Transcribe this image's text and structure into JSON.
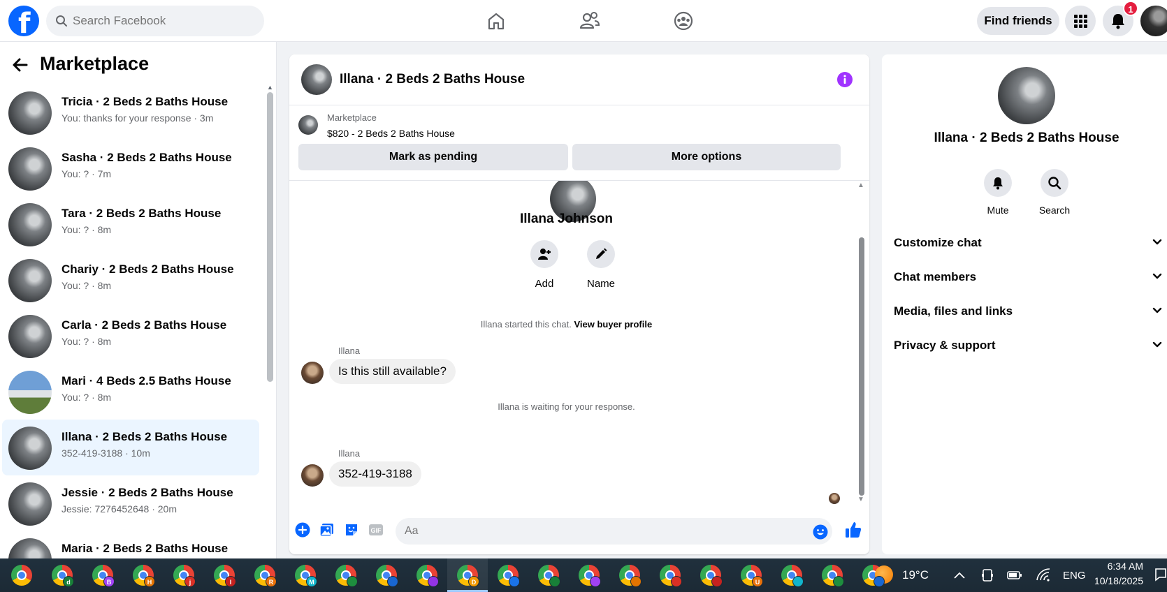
{
  "header": {
    "search_placeholder": "Search Facebook",
    "find_friends": "Find friends",
    "notification_count": "1"
  },
  "sidebar": {
    "title": "Marketplace",
    "conversations": [
      {
        "name": "Tricia · 2 Beds 2 Baths House",
        "preview": "You: thanks for your response · 3m"
      },
      {
        "name": "Sasha · 2 Beds 2 Baths House",
        "preview": "You: ? · 7m"
      },
      {
        "name": "Tara · 2 Beds 2 Baths House",
        "preview": "You: ? · 8m"
      },
      {
        "name": "Chariy · 2 Beds 2 Baths House",
        "preview": "You: ? · 8m"
      },
      {
        "name": "Carla · 2 Beds 2 Baths House",
        "preview": "You: ? · 8m"
      },
      {
        "name": "Mari · 4 Beds 2.5 Baths House",
        "preview": "You: ? · 8m"
      },
      {
        "name": "Illana · 2 Beds 2 Baths House",
        "preview": "352-419-3188 · 10m"
      },
      {
        "name": "Jessie · 2 Beds 2 Baths House",
        "preview": "Jessie: 7276452648 · 20m"
      },
      {
        "name": "Maria · 2 Beds 2 Baths House",
        "preview": ""
      }
    ]
  },
  "chat": {
    "title": "Illana · 2 Beds 2 Baths House",
    "listing_label": "Marketplace",
    "listing_price": "$820 - 2 Beds 2 Baths House",
    "mark_pending": "Mark as pending",
    "more_options": "More options",
    "profile_name": "Illana Johnson",
    "actions": [
      {
        "label": "Add"
      },
      {
        "label": "Name"
      }
    ],
    "started_text": "Illana started this chat.",
    "view_profile": "View buyer profile",
    "waiting_text": "Illana is waiting for your response.",
    "messages": [
      {
        "sender": "Illana",
        "text": "Is this still available?"
      },
      {
        "sender": "Illana",
        "text": "352-419-3188"
      }
    ],
    "composer_placeholder": "Aa"
  },
  "details": {
    "title": "Illana · 2 Beds 2 Baths House",
    "actions": [
      {
        "label": "Mute"
      },
      {
        "label": "Search"
      }
    ],
    "sections": [
      "Customize chat",
      "Chat members",
      "Media, files and links",
      "Privacy & support"
    ]
  },
  "taskbar": {
    "profile_badges": [
      "",
      "d",
      "B",
      "H",
      "j",
      "I",
      "R",
      "M",
      "",
      "",
      "",
      "D",
      "",
      "",
      "",
      "",
      "",
      "",
      "U",
      "",
      "",
      ""
    ],
    "temperature": "19°C",
    "language": "ENG",
    "time": "6:34 AM",
    "date": "10/18/2025"
  },
  "colors": {
    "brand": "#0866ff",
    "active_row": "#ebf5ff",
    "info_purple": "#a033ff"
  }
}
